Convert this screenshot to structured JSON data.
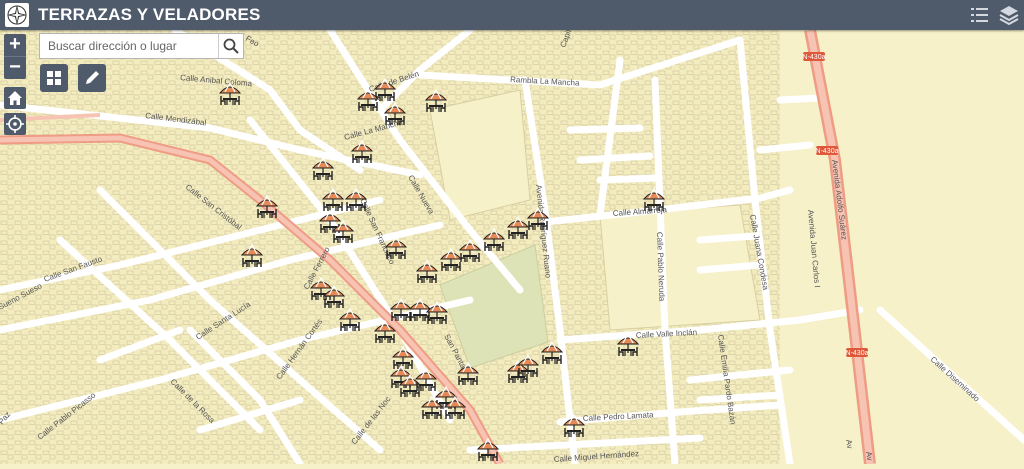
{
  "app": {
    "title": "TERRAZAS Y VELADORES"
  },
  "search": {
    "placeholder": "Buscar dirección o lugar"
  },
  "controls": {
    "zoom_in": "+",
    "zoom_out": "−"
  },
  "streets": {
    "feo": "Feo",
    "annibal": "Calle Anibal Coloma",
    "belen": "Calle de Belén",
    "rambla": "Rambla La Mancha",
    "capital": "Capital",
    "mendizabal": "Calle Mendizábal",
    "lamancha": "Calle La Mancha",
    "nueva": "Calle Nueva",
    "sancristobal": "Calle San Cristóbal",
    "sanfrancisco": "Calle San Francisco",
    "ferrero": "Calle Ferrero",
    "sanfausto": "Calle San Fausto",
    "suenosueso": "Sueno Sueso",
    "santalucia": "Calle Santa Lucía",
    "larosa": "Calle de la Rosa",
    "picasso": "Calle Pablo Picasso",
    "paz": "Paz",
    "hernan": "Calle Hernán Cortés",
    "delasnoc": "Calle de las Noc",
    "sanpant": "San Panta",
    "avrod": "Avenida Rodríguez Ruano",
    "almarroja": "Calle Almarroja",
    "neruda": "Calle Pablo Neruda",
    "condesa": "Calle Juana Condesa",
    "adolfo": "Avenida Adolfo Suárez",
    "juancarlos": "Avenida Juan Carlos I",
    "valleinclan": "Calle Valle Inclán",
    "emilia": "Calle Emilia Pardo Bazán",
    "lamata": "Calle Pedro Lamata",
    "miguel": "Calle Miguel Hernández",
    "diseminado": "Calle Diseminado",
    "n430": "N-430a",
    "avs": "Av"
  },
  "colors": {
    "header": "#4f5a6b",
    "map_bg": "#f6f1c9",
    "highway": "#ef9c85",
    "park": "#dde3b6",
    "marker": "#e58a56"
  },
  "icons": {
    "logo": "compass-logo-icon",
    "search": "search-icon",
    "list": "list-icon",
    "layers": "layers-icon",
    "home": "home-icon",
    "locate": "locate-icon",
    "basemap": "grid-icon",
    "edit": "pencil-icon",
    "marker": "terrace-umbrella-icon"
  }
}
